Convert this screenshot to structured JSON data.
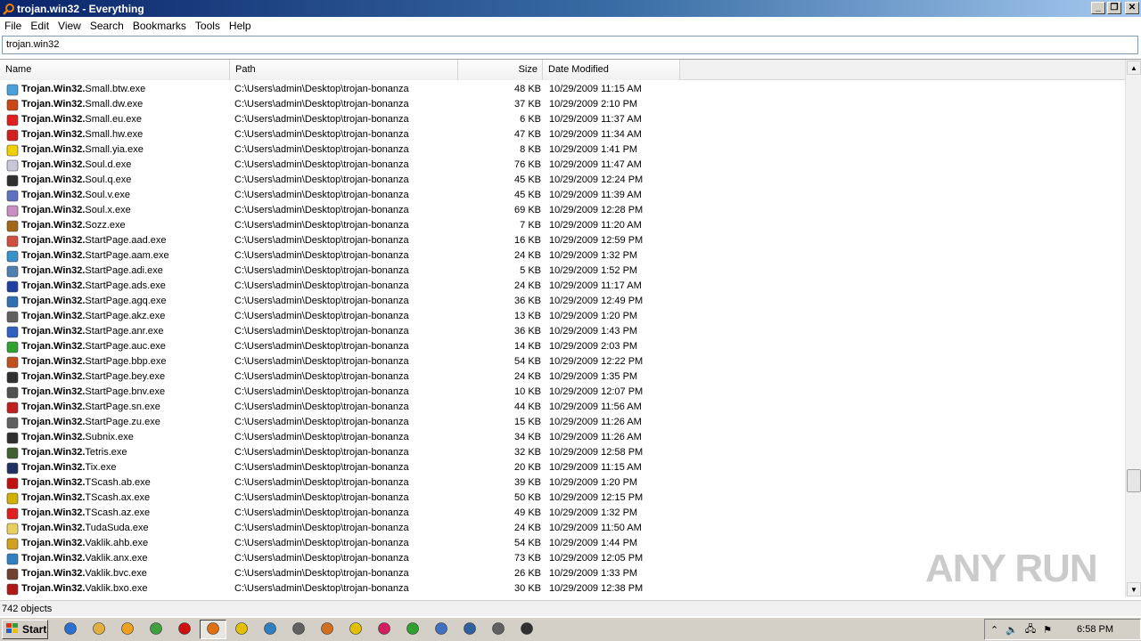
{
  "window": {
    "title": "trojan.win32 - Everything"
  },
  "menu": [
    "File",
    "Edit",
    "View",
    "Search",
    "Bookmarks",
    "Tools",
    "Help"
  ],
  "search": {
    "value": "trojan.win32"
  },
  "columns": {
    "name": "Name",
    "path": "Path",
    "size": "Size",
    "date": "Date Modified"
  },
  "rows": [
    {
      "prefix": "Trojan.Win32.",
      "rest": "Small.btw.exe",
      "path": "C:\\Users\\admin\\Desktop\\trojan-bonanza",
      "size": "48 KB",
      "date": "10/29/2009 11:15 AM",
      "icon": "globe-doc-icon",
      "color": "#4aa0d8"
    },
    {
      "prefix": "Trojan.Win32.",
      "rest": "Small.dw.exe",
      "path": "C:\\Users\\admin\\Desktop\\trojan-bonanza",
      "size": "37 KB",
      "date": "10/29/2009 2:10 PM",
      "icon": "person-icon",
      "color": "#c84818"
    },
    {
      "prefix": "Trojan.Win32.",
      "rest": "Small.eu.exe",
      "path": "C:\\Users\\admin\\Desktop\\trojan-bonanza",
      "size": "6 KB",
      "date": "10/29/2009 11:37 AM",
      "icon": "error-icon",
      "color": "#e02020"
    },
    {
      "prefix": "Trojan.Win32.",
      "rest": "Small.hw.exe",
      "path": "C:\\Users\\admin\\Desktop\\trojan-bonanza",
      "size": "47 KB",
      "date": "10/29/2009 11:34 AM",
      "icon": "monitor-flag-icon",
      "color": "#d02020"
    },
    {
      "prefix": "Trojan.Win32.",
      "rest": "Small.yia.exe",
      "path": "C:\\Users\\admin\\Desktop\\trojan-bonanza",
      "size": "8 KB",
      "date": "10/29/2009 1:41 PM",
      "icon": "warning-icon",
      "color": "#f0d000"
    },
    {
      "prefix": "Trojan.Win32.",
      "rest": "Soul.d.exe",
      "path": "C:\\Users\\admin\\Desktop\\trojan-bonanza",
      "size": "76 KB",
      "date": "10/29/2009 11:47 AM",
      "icon": "blank-icon",
      "color": "#c8c8d8"
    },
    {
      "prefix": "Trojan.Win32.",
      "rest": "Soul.q.exe",
      "path": "C:\\Users\\admin\\Desktop\\trojan-bonanza",
      "size": "45 KB",
      "date": "10/29/2009 12:24 PM",
      "icon": "gears-icon",
      "color": "#303030"
    },
    {
      "prefix": "Trojan.Win32.",
      "rest": "Soul.v.exe",
      "path": "C:\\Users\\admin\\Desktop\\trojan-bonanza",
      "size": "45 KB",
      "date": "10/29/2009 11:39 AM",
      "icon": "document-icon",
      "color": "#6070c0"
    },
    {
      "prefix": "Trojan.Win32.",
      "rest": "Soul.x.exe",
      "path": "C:\\Users\\admin\\Desktop\\trojan-bonanza",
      "size": "69 KB",
      "date": "10/29/2009 12:28 PM",
      "icon": "blank-icon",
      "color": "#c890c0"
    },
    {
      "prefix": "Trojan.Win32.",
      "rest": "Sozz.exe",
      "path": "C:\\Users\\admin\\Desktop\\trojan-bonanza",
      "size": "7 KB",
      "date": "10/29/2009 11:20 AM",
      "icon": "badge-icon",
      "color": "#a06818"
    },
    {
      "prefix": "Trojan.Win32.",
      "rest": "StartPage.aad.exe",
      "path": "C:\\Users\\admin\\Desktop\\trojan-bonanza",
      "size": "16 KB",
      "date": "10/29/2009 12:59 PM",
      "icon": "image-icon",
      "color": "#d05040"
    },
    {
      "prefix": "Trojan.Win32.",
      "rest": "StartPage.aam.exe",
      "path": "C:\\Users\\admin\\Desktop\\trojan-bonanza",
      "size": "24 KB",
      "date": "10/29/2009 1:32 PM",
      "icon": "install-icon",
      "color": "#3890c8"
    },
    {
      "prefix": "Trojan.Win32.",
      "rest": "StartPage.adi.exe",
      "path": "C:\\Users\\admin\\Desktop\\trojan-bonanza",
      "size": "5 KB",
      "date": "10/29/2009 1:52 PM",
      "icon": "setup-icon",
      "color": "#5080b0"
    },
    {
      "prefix": "Trojan.Win32.",
      "rest": "StartPage.ads.exe",
      "path": "C:\\Users\\admin\\Desktop\\trojan-bonanza",
      "size": "24 KB",
      "date": "10/29/2009 11:17 AM",
      "icon": "setup-icon",
      "color": "#2040a0"
    },
    {
      "prefix": "Trojan.Win32.",
      "rest": "StartPage.agq.exe",
      "path": "C:\\Users\\admin\\Desktop\\trojan-bonanza",
      "size": "36 KB",
      "date": "10/29/2009 12:49 PM",
      "icon": "setup-icon",
      "color": "#3070b0"
    },
    {
      "prefix": "Trojan.Win32.",
      "rest": "StartPage.akz.exe",
      "path": "C:\\Users\\admin\\Desktop\\trojan-bonanza",
      "size": "13 KB",
      "date": "10/29/2009 1:20 PM",
      "icon": "notepad-icon",
      "color": "#606060"
    },
    {
      "prefix": "Trojan.Win32.",
      "rest": "StartPage.anr.exe",
      "path": "C:\\Users\\admin\\Desktop\\trojan-bonanza",
      "size": "36 KB",
      "date": "10/29/2009 1:43 PM",
      "icon": "globe-icon",
      "color": "#3060c0"
    },
    {
      "prefix": "Trojan.Win32.",
      "rest": "StartPage.auc.exe",
      "path": "C:\\Users\\admin\\Desktop\\trojan-bonanza",
      "size": "14 KB",
      "date": "10/29/2009 2:03 PM",
      "icon": "recycle-icon",
      "color": "#30a030"
    },
    {
      "prefix": "Trojan.Win32.",
      "rest": "StartPage.bbp.exe",
      "path": "C:\\Users\\admin\\Desktop\\trojan-bonanza",
      "size": "54 KB",
      "date": "10/29/2009 12:22 PM",
      "icon": "java-icon",
      "color": "#c05020"
    },
    {
      "prefix": "Trojan.Win32.",
      "rest": "StartPage.bey.exe",
      "path": "C:\\Users\\admin\\Desktop\\trojan-bonanza",
      "size": "24 KB",
      "date": "10/29/2009 1:35 PM",
      "icon": "disk-icon",
      "color": "#303030"
    },
    {
      "prefix": "Trojan.Win32.",
      "rest": "StartPage.bnv.exe",
      "path": "C:\\Users\\admin\\Desktop\\trojan-bonanza",
      "size": "10 KB",
      "date": "10/29/2009 12:07 PM",
      "icon": "drive-icon",
      "color": "#505050"
    },
    {
      "prefix": "Trojan.Win32.",
      "rest": "StartPage.sn.exe",
      "path": "C:\\Users\\admin\\Desktop\\trojan-bonanza",
      "size": "44 KB",
      "date": "10/29/2009 11:56 AM",
      "icon": "person-icon",
      "color": "#c02020"
    },
    {
      "prefix": "Trojan.Win32.",
      "rest": "StartPage.zu.exe",
      "path": "C:\\Users\\admin\\Desktop\\trojan-bonanza",
      "size": "15 KB",
      "date": "10/29/2009 11:26 AM",
      "icon": "setup-icon",
      "color": "#606060"
    },
    {
      "prefix": "Trojan.Win32.",
      "rest": "Subnix.exe",
      "path": "C:\\Users\\admin\\Desktop\\trojan-bonanza",
      "size": "34 KB",
      "date": "10/29/2009 11:26 AM",
      "icon": "monitor-icon",
      "color": "#303030"
    },
    {
      "prefix": "Trojan.Win32.",
      "rest": "Tetris.exe",
      "path": "C:\\Users\\admin\\Desktop\\trojan-bonanza",
      "size": "32 KB",
      "date": "10/29/2009 12:58 PM",
      "icon": "game-icon",
      "color": "#406030"
    },
    {
      "prefix": "Trojan.Win32.",
      "rest": "Tix.exe",
      "path": "C:\\Users\\admin\\Desktop\\trojan-bonanza",
      "size": "20 KB",
      "date": "10/29/2009 11:15 AM",
      "icon": "table-icon",
      "color": "#203060"
    },
    {
      "prefix": "Trojan.Win32.",
      "rest": "TScash.ab.exe",
      "path": "C:\\Users\\admin\\Desktop\\trojan-bonanza",
      "size": "39 KB",
      "date": "10/29/2009 1:20 PM",
      "icon": "heart-icon",
      "color": "#c01010"
    },
    {
      "prefix": "Trojan.Win32.",
      "rest": "TScash.ax.exe",
      "path": "C:\\Users\\admin\\Desktop\\trojan-bonanza",
      "size": "50 KB",
      "date": "10/29/2009 12:15 PM",
      "icon": "lightning-icon",
      "color": "#d0b000"
    },
    {
      "prefix": "Trojan.Win32.",
      "rest": "TScash.az.exe",
      "path": "C:\\Users\\admin\\Desktop\\trojan-bonanza",
      "size": "49 KB",
      "date": "10/29/2009 1:32 PM",
      "icon": "app-red-icon",
      "color": "#e02020"
    },
    {
      "prefix": "Trojan.Win32.",
      "rest": "TudaSuda.exe",
      "path": "C:\\Users\\admin\\Desktop\\trojan-bonanza",
      "size": "24 KB",
      "date": "10/29/2009 11:50 AM",
      "icon": "folder-icon",
      "color": "#e8d060"
    },
    {
      "prefix": "Trojan.Win32.",
      "rest": "Vaklik.ahb.exe",
      "path": "C:\\Users\\admin\\Desktop\\trojan-bonanza",
      "size": "54 KB",
      "date": "10/29/2009 1:44 PM",
      "icon": "bottle-icon",
      "color": "#d0a020"
    },
    {
      "prefix": "Trojan.Win32.",
      "rest": "Vaklik.anx.exe",
      "path": "C:\\Users\\admin\\Desktop\\trojan-bonanza",
      "size": "73 KB",
      "date": "10/29/2009 12:05 PM",
      "icon": "users-icon",
      "color": "#3080c0"
    },
    {
      "prefix": "Trojan.Win32.",
      "rest": "Vaklik.bvc.exe",
      "path": "C:\\Users\\admin\\Desktop\\trojan-bonanza",
      "size": "26 KB",
      "date": "10/29/2009 1:33 PM",
      "icon": "face-icon",
      "color": "#704030"
    },
    {
      "prefix": "Trojan.Win32.",
      "rest": "Vaklik.bxo.exe",
      "path": "C:\\Users\\admin\\Desktop\\trojan-bonanza",
      "size": "30 KB",
      "date": "10/29/2009 12:38 PM",
      "icon": "scissors-icon",
      "color": "#b01818"
    }
  ],
  "status": {
    "text": "742 objects"
  },
  "taskbar": {
    "start_label": "Start",
    "clock": "6:58 PM",
    "quick_launch": [
      {
        "icon": "ie-icon",
        "color": "#2a70d0"
      },
      {
        "icon": "explorer-icon",
        "color": "#e0b040"
      },
      {
        "icon": "media-player-icon",
        "color": "#f0a020"
      },
      {
        "icon": "chrome-icon",
        "color": "#40a040"
      },
      {
        "icon": "opera-icon",
        "color": "#d01010"
      },
      {
        "icon": "everything-icon",
        "color": "#e07010"
      },
      {
        "icon": "sun-icon",
        "color": "#e0c000"
      },
      {
        "icon": "users-icon",
        "color": "#3080c0"
      },
      {
        "icon": "hand-icon",
        "color": "#606060"
      },
      {
        "icon": "calendar-icon",
        "color": "#d07020"
      },
      {
        "icon": "radiation-icon",
        "color": "#e0c000"
      },
      {
        "icon": "flower-icon",
        "color": "#d02060"
      },
      {
        "icon": "recycle-icon",
        "color": "#30a030"
      },
      {
        "icon": "window-icon",
        "color": "#4070c0"
      },
      {
        "icon": "chart-icon",
        "color": "#3060a0"
      },
      {
        "icon": "network-icon",
        "color": "#606060"
      },
      {
        "icon": "floppy-icon",
        "color": "#303030"
      }
    ]
  },
  "watermark": {
    "text": "ANY RUN"
  }
}
